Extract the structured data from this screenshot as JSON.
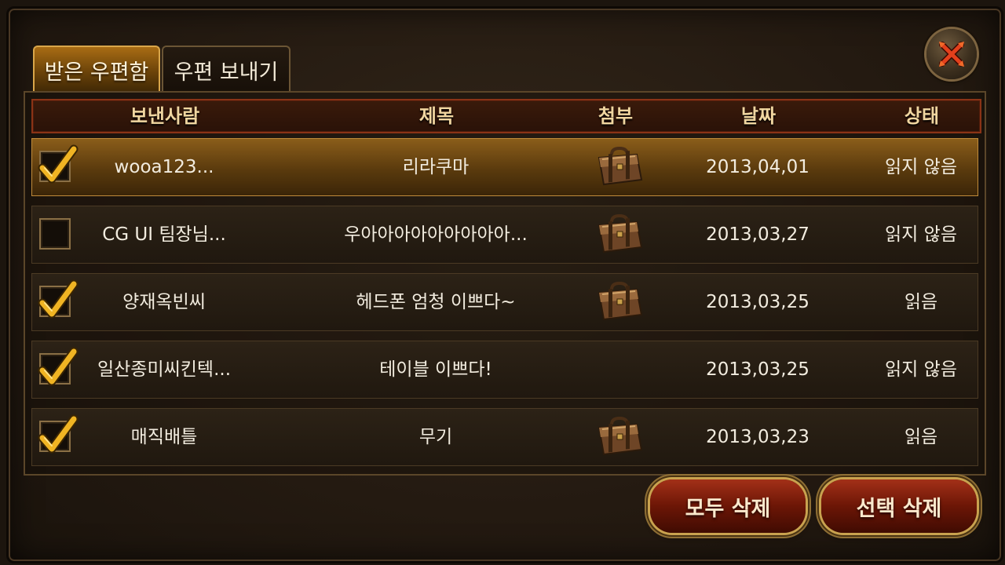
{
  "tabs": {
    "inbox": "받은 우편함",
    "send": "우편 보내기"
  },
  "columns": {
    "sender": "보낸사람",
    "subject": "제목",
    "attachment": "첨부",
    "date": "날짜",
    "status": "상태"
  },
  "mails": [
    {
      "checked": true,
      "selected": true,
      "sender": "wooa123...",
      "subject": "리라쿠마",
      "attachment": true,
      "date": "2013,04,01",
      "status": "읽지 않음"
    },
    {
      "checked": false,
      "selected": false,
      "sender": "CG UI 팀장님...",
      "subject": "우아아아아아아아아아...",
      "attachment": true,
      "date": "2013,03,27",
      "status": "읽지 않음"
    },
    {
      "checked": true,
      "selected": false,
      "sender": "양재옥빈씨",
      "subject": "헤드폰 엄청 이쁘다~",
      "attachment": true,
      "date": "2013,03,25",
      "status": "읽음"
    },
    {
      "checked": true,
      "selected": false,
      "sender": "일산종미씨킨텍...",
      "subject": "테이블 이쁘다!",
      "attachment": false,
      "date": "2013,03,25",
      "status": "읽지 않음"
    },
    {
      "checked": true,
      "selected": false,
      "sender": "매직배틀",
      "subject": "무기",
      "attachment": true,
      "date": "2013,03,23",
      "status": "읽음"
    }
  ],
  "buttons": {
    "delete_all": "모두 삭제",
    "delete_selected": "선택 삭제"
  },
  "icons": {
    "close": "close-x-icon",
    "attachment": "briefcase-icon",
    "check": "checkmark-icon"
  }
}
